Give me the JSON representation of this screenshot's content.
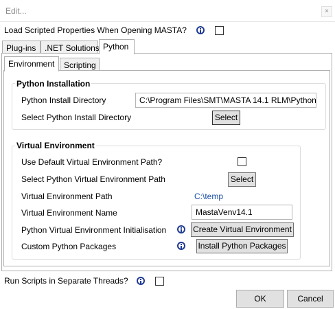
{
  "window": {
    "title": "Edit...",
    "close_glyph": "×"
  },
  "top_option": {
    "label": "Load Scripted Properties When Opening MASTA?",
    "checked": false,
    "icon": "info-icon"
  },
  "outer_tabs": [
    {
      "label": "Plug-ins",
      "active": false
    },
    {
      "label": ".NET Solutions",
      "active": false
    },
    {
      "label": "Python",
      "active": true
    }
  ],
  "inner_tabs": [
    {
      "label": "Environment",
      "active": true
    },
    {
      "label": "Scripting",
      "active": false
    }
  ],
  "python_installation": {
    "title": "Python Installation",
    "install_dir_label": "Python Install Directory",
    "install_dir_value": "C:\\Program Files\\SMT\\MASTA 14.1 RLM\\Python",
    "select_dir_label": "Select Python Install Directory",
    "select_button": "Select"
  },
  "virtual_environment": {
    "title": "Virtual Environment",
    "use_default_label": "Use Default Virtual Environment Path?",
    "use_default_checked": false,
    "select_path_label": "Select Python Virtual Environment Path",
    "select_button": "Select",
    "path_label": "Virtual Environment Path",
    "path_value": "C:\\temp",
    "name_label": "Virtual Environment Name",
    "name_value": "MastaVenv14.1",
    "init_label": "Python Virtual Environment Initialisation",
    "init_button": "Create Virtual Environment",
    "packages_label": "Custom Python Packages",
    "packages_button": "Install Python Packages"
  },
  "bottom_option": {
    "label": "Run Scripts in Separate Threads?",
    "checked": false,
    "icon": "info-icon"
  },
  "footer": {
    "ok_label": "OK",
    "cancel_label": "Cancel"
  },
  "colors": {
    "link": "#1a4fa3",
    "info_icon": "#1f3a93"
  }
}
